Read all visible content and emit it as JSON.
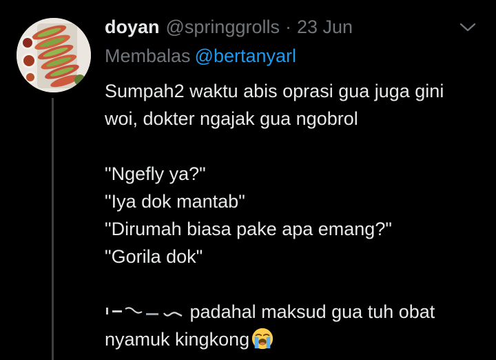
{
  "tweet": {
    "author_name": "doyan",
    "author_handle": "@springgrolls",
    "separator": "·",
    "date": "23 Jun",
    "reply_label": "Membalas",
    "reply_to": "@bertanyarl",
    "lines": [
      "Sumpah2 waktu abis oprasi gua juga gini",
      "woi, dokter ngajak gua ngobrol",
      "\"Ngefly ya?\"",
      "\"Iya dok mantab\"",
      "\"Dirumah biasa pake apa emang?\"",
      "\"Gorila dok\"",
      "padahal maksud gua tuh obat",
      "nyamuk kingkong"
    ]
  },
  "icons": {
    "more": "chevron-down-icon",
    "emoji": "loudly-crying-face-emoji"
  },
  "colors": {
    "background": "#000000",
    "primary_text": "#e7e9ea",
    "secondary_text": "#71767b",
    "link": "#1d9bf0",
    "thread_line": "#3e4144"
  }
}
